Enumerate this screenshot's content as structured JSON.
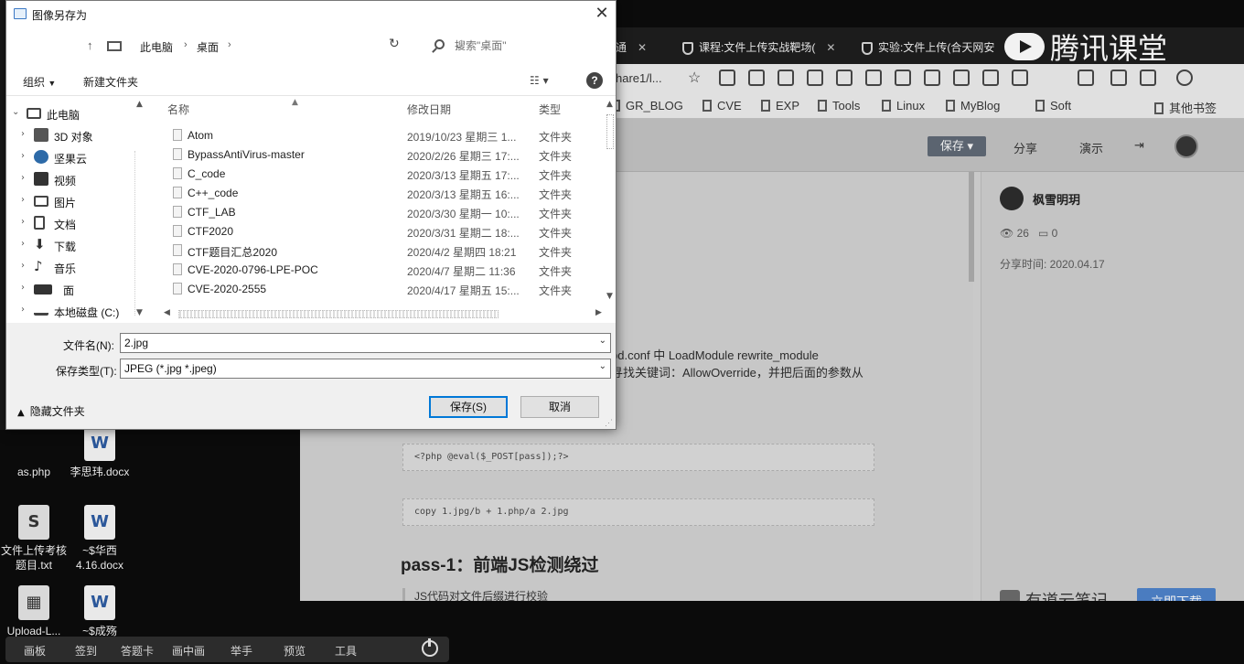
{
  "desktop": {
    "icons": [
      {
        "label": "as.php",
        "glyph": "php-icon"
      },
      {
        "label": "李思玮.docx",
        "glyph": "word-icon"
      },
      {
        "label": "文件上传考核题目.txt",
        "glyph": "document-icon"
      },
      {
        "label": "~$华西4.16.docx",
        "glyph": "word-icon"
      },
      {
        "label": "Upload-L...",
        "glyph": "document-icon"
      },
      {
        "label": "~$成殇",
        "glyph": "word-icon"
      }
    ]
  },
  "taskbar": {
    "items": [
      "画板",
      "签到",
      "答题卡",
      "画中画",
      "举手",
      "预览",
      "工具"
    ]
  },
  "browser": {
    "tabs": [
      {
        "label": "通"
      },
      {
        "label": "课程:文件上传实战靶场("
      },
      {
        "label": "实验:文件上传(合天网安"
      }
    ],
    "brand": "腾讯课堂",
    "address_fragment": "hare1/l...",
    "bookmarks": [
      "GR_BLOG",
      "CVE",
      "EXP",
      "Tools",
      "Linux",
      "MyBlog",
      "Soft",
      "其他书签"
    ],
    "toolbar": {
      "save_share": "保存",
      "share": "分享",
      "present": "演示"
    },
    "sidebar": {
      "author": "枫雪明玥",
      "views": "26",
      "comments": "0",
      "share_time": "分享时间: 2020.04.17",
      "ynote": "有道云笔记",
      "download": "立即下载"
    },
    "content": {
      "line1": "pd.conf 中 LoadModule rewrite_module",
      "line2": "寻找关键词：AllowOverride，并把后面的参数从",
      "code1": "<?php @eval($_POST[pass]);?>",
      "code2": "copy 1.jpg/b + 1.php/a 2.jpg",
      "heading": "pass-1：前端JS检测绕过",
      "para": "JS代码对文件后缀进行校验"
    }
  },
  "dialog": {
    "title": "图像另存为",
    "path": [
      "此电脑",
      "桌面"
    ],
    "search_placeholder": "搜索\"桌面\"",
    "organize": "组织",
    "new_folder": "新建文件夹",
    "tree": [
      {
        "label": "此电脑",
        "expanded": true,
        "level": 0,
        "icon": "computer-icon"
      },
      {
        "label": "3D 对象",
        "level": 1,
        "icon": "cube-icon"
      },
      {
        "label": "坚果云",
        "level": 1,
        "icon": "cloud-icon"
      },
      {
        "label": "视频",
        "level": 1,
        "icon": "video-icon"
      },
      {
        "label": "图片",
        "level": 1,
        "icon": "picture-icon"
      },
      {
        "label": "文档",
        "level": 1,
        "icon": "document-icon"
      },
      {
        "label": "下载",
        "level": 1,
        "icon": "download-icon"
      },
      {
        "label": "音乐",
        "level": 1,
        "icon": "music-icon"
      },
      {
        "label": "面",
        "level": 1,
        "icon": "desktop-icon"
      },
      {
        "label": "本地磁盘 (C:)",
        "level": 1,
        "icon": "disk-icon"
      }
    ],
    "columns": {
      "name": "名称",
      "modified": "修改日期",
      "type": "类型"
    },
    "files": [
      {
        "name": "Atom",
        "date": "2019/10/23 星期三 1...",
        "type": "文件夹"
      },
      {
        "name": "BypassAntiVirus-master",
        "date": "2020/2/26 星期三 17:...",
        "type": "文件夹"
      },
      {
        "name": "C_code",
        "date": "2020/3/13 星期五 17:...",
        "type": "文件夹"
      },
      {
        "name": "C++_code",
        "date": "2020/3/13 星期五 16:...",
        "type": "文件夹"
      },
      {
        "name": "CTF_LAB",
        "date": "2020/3/30 星期一 10:...",
        "type": "文件夹"
      },
      {
        "name": "CTF2020",
        "date": "2020/3/31 星期二 18:...",
        "type": "文件夹"
      },
      {
        "name": "CTF题目汇总2020",
        "date": "2020/4/2 星期四 18:21",
        "type": "文件夹"
      },
      {
        "name": "CVE-2020-0796-LPE-POC",
        "date": "2020/4/7 星期二 11:36",
        "type": "文件夹"
      },
      {
        "name": "CVE-2020-2555",
        "date": "2020/4/17 星期五 15:...",
        "type": "文件夹"
      }
    ],
    "filename_label": "文件名(N):",
    "filename_value": "2.jpg",
    "filetype_label": "保存类型(T):",
    "filetype_value": "JPEG (*.jpg *.jpeg)",
    "hide_folders": "隐藏文件夹",
    "save": "保存(S)",
    "cancel": "取消"
  }
}
